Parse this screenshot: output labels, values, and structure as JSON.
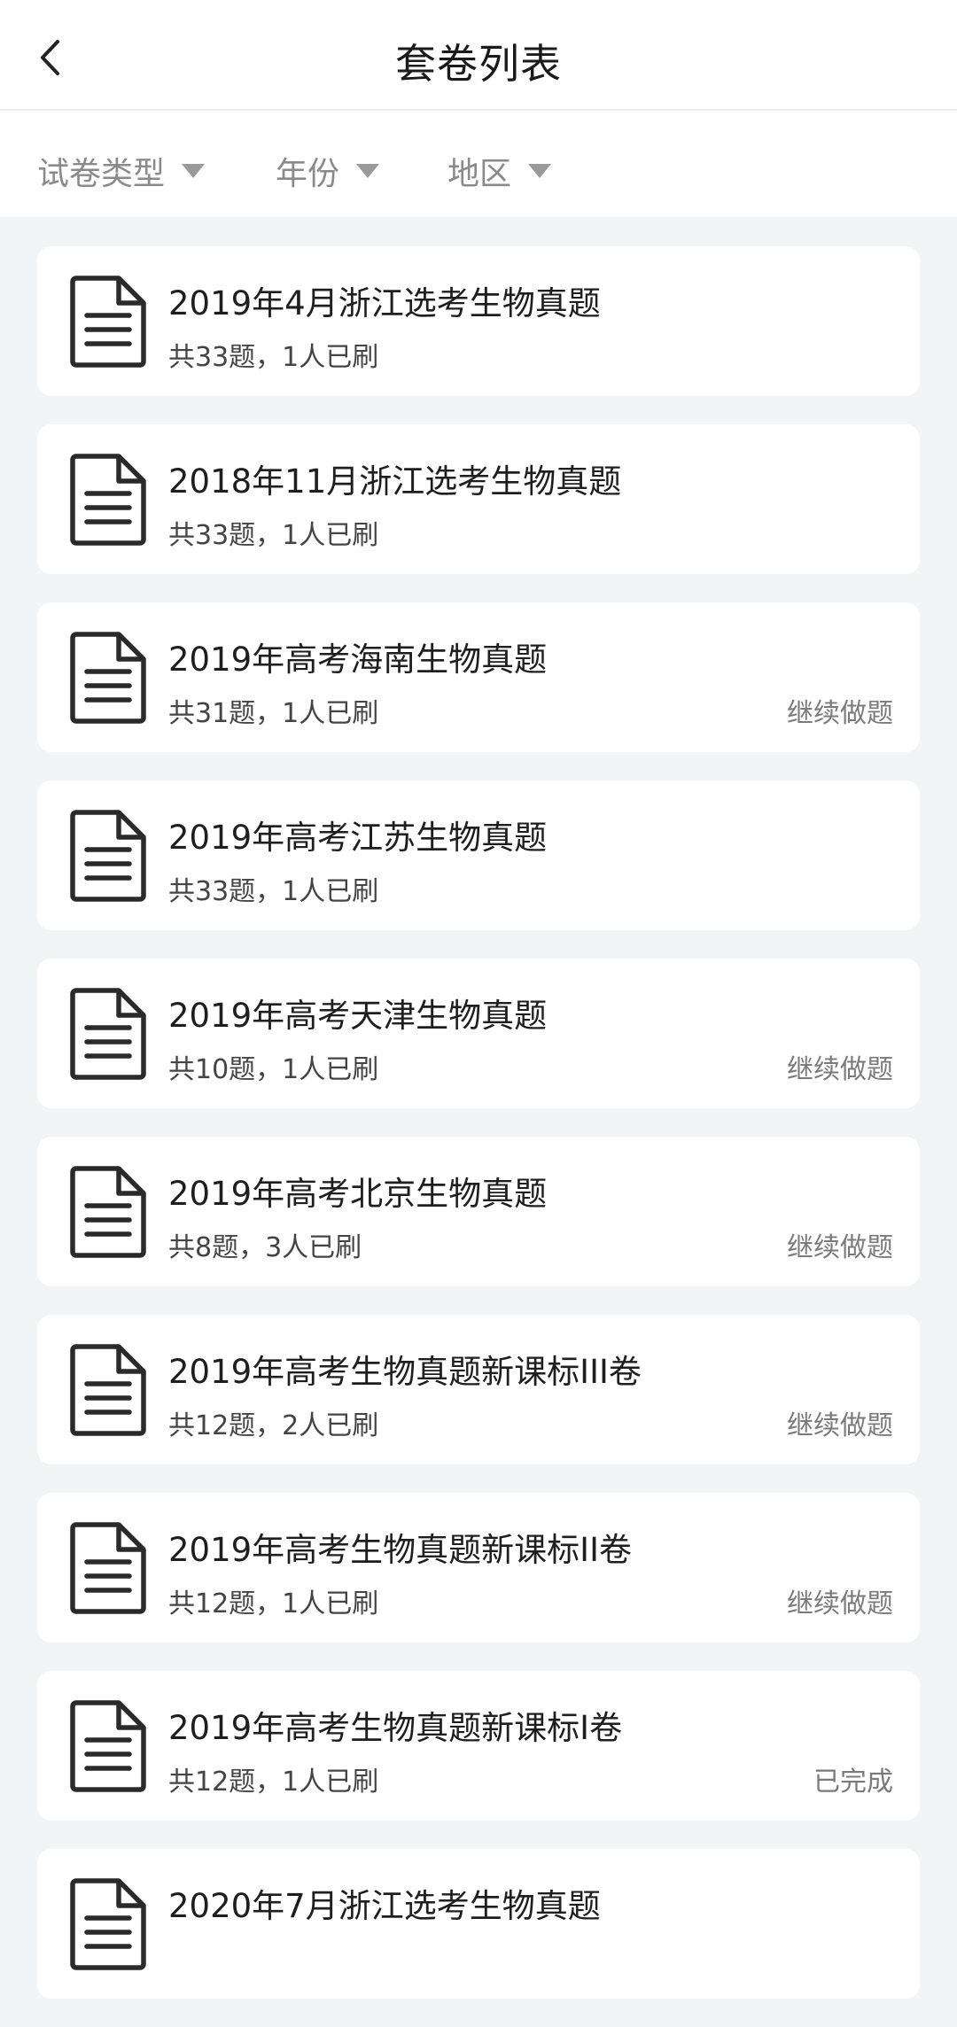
{
  "header": {
    "title": "套卷列表",
    "back_icon": "chevron-left-icon"
  },
  "filters": [
    {
      "label": "试卷类型",
      "icon": "triangle-down-icon"
    },
    {
      "label": "年份",
      "icon": "triangle-down-icon"
    },
    {
      "label": "地区",
      "icon": "triangle-down-icon"
    }
  ],
  "papers": [
    {
      "title": "2019年4月浙江选考生物真题",
      "meta": "共33题，1人已刷",
      "status": ""
    },
    {
      "title": "2018年11月浙江选考生物真题",
      "meta": "共33题，1人已刷",
      "status": ""
    },
    {
      "title": "2019年高考海南生物真题",
      "meta": "共31题，1人已刷",
      "status": "继续做题"
    },
    {
      "title": "2019年高考江苏生物真题",
      "meta": "共33题，1人已刷",
      "status": ""
    },
    {
      "title": "2019年高考天津生物真题",
      "meta": "共10题，1人已刷",
      "status": "继续做题"
    },
    {
      "title": "2019年高考北京生物真题",
      "meta": "共8题，3人已刷",
      "status": "继续做题"
    },
    {
      "title": "2019年高考生物真题新课标III卷",
      "meta": "共12题，2人已刷",
      "status": "继续做题"
    },
    {
      "title": "2019年高考生物真题新课标II卷",
      "meta": "共12题，1人已刷",
      "status": "继续做题"
    },
    {
      "title": "2019年高考生物真题新课标I卷",
      "meta": "共12题，1人已刷",
      "status": "已完成"
    },
    {
      "title": "2020年7月浙江选考生物真题",
      "meta": "",
      "status": ""
    }
  ],
  "colors": {
    "background": "#f3f4f6",
    "card": "#ffffff",
    "title_text": "#1e1e1e",
    "muted_text": "#8a8a8a"
  }
}
